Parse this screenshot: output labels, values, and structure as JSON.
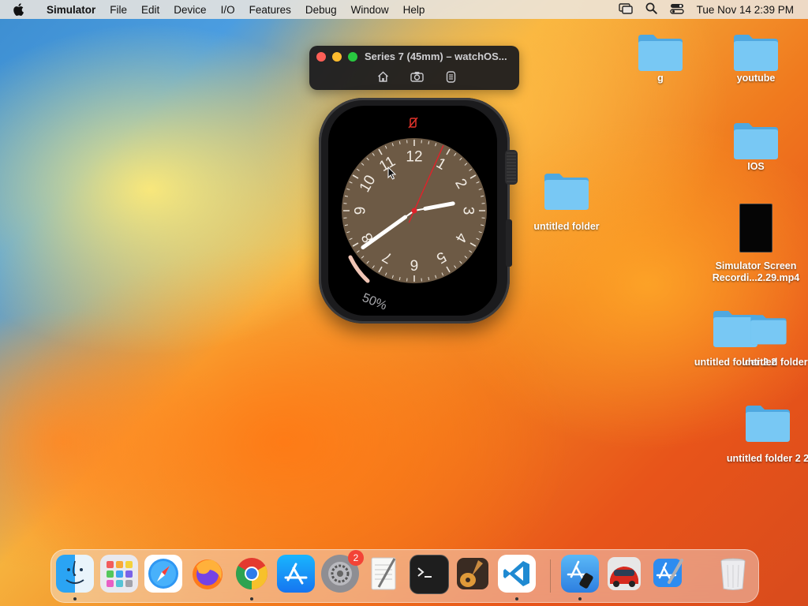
{
  "menubar": {
    "app_name": "Simulator",
    "items": [
      "File",
      "Edit",
      "Device",
      "I/O",
      "Features",
      "Debug",
      "Window",
      "Help"
    ],
    "clock": "Tue Nov 14  2:39 PM"
  },
  "simulator": {
    "title": "Series 7 (45mm) – watchOS...",
    "tools": [
      "home-icon",
      "screenshot-icon",
      "rotate-icon"
    ]
  },
  "watch_face": {
    "numerals": [
      "12",
      "1",
      "2",
      "3",
      "4",
      "5",
      "6",
      "7",
      "8",
      "9",
      "10",
      "11"
    ],
    "battery_percent": "50%",
    "time": {
      "hour": 2,
      "minute": 39,
      "second": 4
    }
  },
  "desktop": {
    "icons": [
      {
        "label": "g",
        "type": "folder"
      },
      {
        "label": "youtube",
        "type": "folder"
      },
      {
        "label": "IOS",
        "type": "folder"
      },
      {
        "label": "untitled folder",
        "type": "folder"
      },
      {
        "label": "Simulator Screen Recordi...2.29.mp4",
        "type": "video"
      },
      {
        "label": "untitled folder 2 2",
        "type": "folder"
      },
      {
        "label": "untitled folder 2",
        "type": "folder"
      },
      {
        "label": "untitled folder 2 2",
        "type": "folder"
      }
    ]
  },
  "dock": {
    "apps": [
      {
        "name": "Finder",
        "icon": "finder-icon"
      },
      {
        "name": "Launchpad",
        "icon": "launchpad-icon"
      },
      {
        "name": "Safari",
        "icon": "safari-icon"
      },
      {
        "name": "Firefox",
        "icon": "firefox-icon"
      },
      {
        "name": "Google Chrome",
        "icon": "chrome-icon"
      },
      {
        "name": "App Store",
        "icon": "app-store-icon"
      },
      {
        "name": "System Settings",
        "icon": "settings-icon",
        "badge": "2"
      },
      {
        "name": "TextEdit",
        "icon": "textedit-icon"
      },
      {
        "name": "Terminal",
        "icon": "terminal-icon"
      },
      {
        "name": "GarageBand",
        "icon": "garageband-icon"
      },
      {
        "name": "Visual Studio Code",
        "icon": "vscode-icon"
      },
      {
        "name": "Simulator",
        "icon": "simulator-icon"
      },
      {
        "name": "Racing Game",
        "icon": "racing-game-icon"
      },
      {
        "name": "Xcode",
        "icon": "xcode-icon"
      },
      {
        "name": "Trash",
        "icon": "trash-icon"
      }
    ]
  },
  "colors": {
    "folder_blue": "#6cc3f2",
    "second_hand": "#e0222a",
    "dial": "#6d5a45"
  }
}
